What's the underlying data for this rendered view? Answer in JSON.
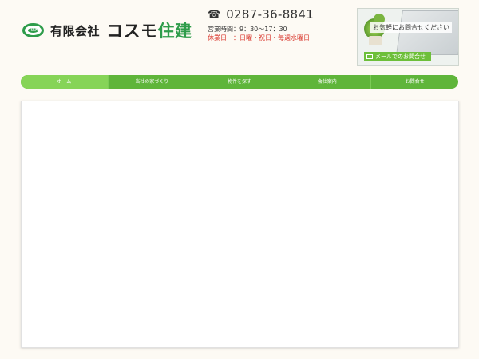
{
  "header": {
    "logo": {
      "mark_text": "住建",
      "company_type": "有限会社",
      "name_part1": "コスモ",
      "name_part2": "住建",
      "icon": "cosmo-logo-icon"
    },
    "contact": {
      "phone_icon": "phone-icon",
      "phone": "0287-36-8841",
      "hours": "営業時間：9：30～17：30",
      "holiday": "休業日　：日曜・祝日・毎週水曜日"
    },
    "banner": {
      "text": "お気軽にお問合せください",
      "button_label": "メールでのお問合せ",
      "icon": "mail-icon"
    }
  },
  "nav": {
    "items": [
      {
        "label": "ホーム"
      },
      {
        "label": "当社の家づくり"
      },
      {
        "label": "物件を探す"
      },
      {
        "label": "会社案内"
      },
      {
        "label": "お問合せ"
      }
    ]
  },
  "colors": {
    "accent": "#5fb53a",
    "active": "#86d457",
    "holiday": "#d9352b",
    "background": "#fdfaf4"
  }
}
